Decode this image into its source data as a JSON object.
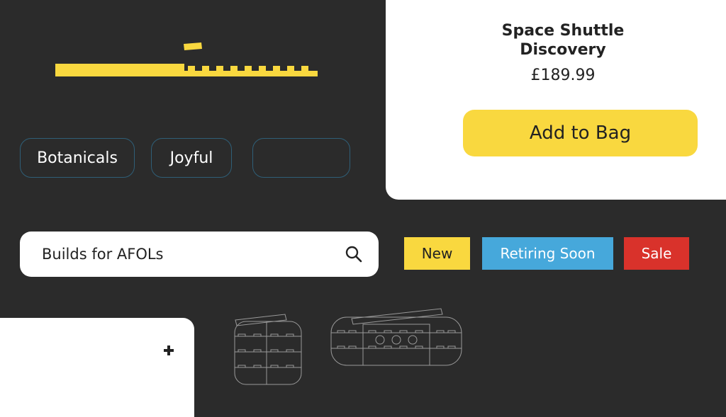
{
  "pills": [
    "Botanicals",
    "Joyful",
    ""
  ],
  "product": {
    "title_line1": "Space Shuttle",
    "title_line2": "Discovery",
    "price": "£189.99",
    "add_label": "Add to Bag"
  },
  "search": {
    "value": "Builds for AFOLs",
    "icon": "search-icon"
  },
  "badges": {
    "new": "New",
    "retiring": "Retiring Soon",
    "sale": "Sale"
  },
  "panel": {
    "icon": "plus-icon"
  },
  "colors": {
    "background": "#2b2b2b",
    "yellow": "#f9d83f",
    "blue": "#46a8db",
    "red": "#d9322b",
    "pill_border": "#2f5f78"
  }
}
